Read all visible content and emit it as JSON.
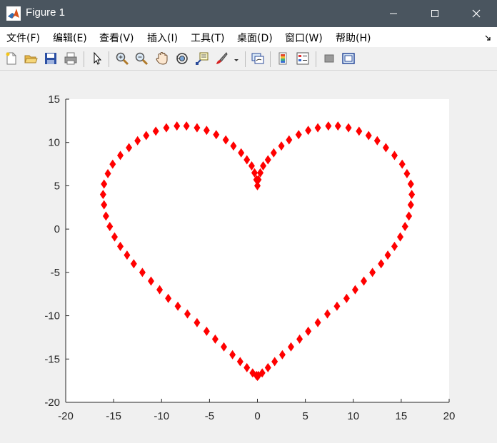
{
  "window": {
    "title": "Figure 1",
    "title_bar_color": "#4a555f"
  },
  "menu": {
    "items": [
      "文件(F)",
      "编辑(E)",
      "查看(V)",
      "插入(I)",
      "工具(T)",
      "桌面(D)",
      "窗口(W)",
      "帮助(H)"
    ]
  },
  "toolbar": {
    "icons": [
      "new-figure-icon",
      "open-file-icon",
      "save-icon",
      "print-icon",
      "edit-plot-arrow-icon",
      "zoom-in-icon",
      "zoom-out-icon",
      "pan-hand-icon",
      "rotate-3d-icon",
      "data-cursor-icon",
      "brush-icon",
      "brush-dropdown-icon",
      "link-plot-icon",
      "insert-colorbar-icon",
      "insert-legend-icon",
      "hide-plot-tools-icon",
      "show-plot-tools-icon"
    ]
  },
  "chart_data": {
    "type": "scatter",
    "marker": "diamond",
    "marker_color": "#ff0000",
    "title": "",
    "xlabel": "",
    "ylabel": "",
    "xlim": [
      -20,
      20
    ],
    "ylim": [
      -20,
      15
    ],
    "xticks": [
      "-20",
      "-15",
      "-10",
      "-5",
      "0",
      "5",
      "10",
      "15",
      "20"
    ],
    "yticks": [
      "15",
      "10",
      "5",
      "0",
      "-5",
      "-10",
      "-15",
      "-20"
    ],
    "grid": false,
    "points": [
      [
        0,
        5
      ],
      [
        0.1,
        5.7
      ],
      [
        0.3,
        6.5
      ],
      [
        0.6,
        7.3
      ],
      [
        1.1,
        8.0
      ],
      [
        1.7,
        8.8
      ],
      [
        2.5,
        9.6
      ],
      [
        3.3,
        10.3
      ],
      [
        4.3,
        10.9
      ],
      [
        5.3,
        11.4
      ],
      [
        6.3,
        11.7
      ],
      [
        7.4,
        11.9
      ],
      [
        8.4,
        11.9
      ],
      [
        9.5,
        11.7
      ],
      [
        10.6,
        11.3
      ],
      [
        11.6,
        10.8
      ],
      [
        12.5,
        10.2
      ],
      [
        13.4,
        9.4
      ],
      [
        14.3,
        8.5
      ],
      [
        15.1,
        7.5
      ],
      [
        15.6,
        6.4
      ],
      [
        16,
        5.2
      ],
      [
        16.1,
        4.0
      ],
      [
        16,
        2.8
      ],
      [
        15.8,
        1.5
      ],
      [
        15.4,
        0.3
      ],
      [
        14.9,
        -0.9
      ],
      [
        14.3,
        -2.0
      ],
      [
        13.6,
        -3.0
      ],
      [
        12.9,
        -4.0
      ],
      [
        12.0,
        -5.0
      ],
      [
        11.1,
        -6.0
      ],
      [
        10.2,
        -7.0
      ],
      [
        9.3,
        -8.0
      ],
      [
        8.3,
        -8.9
      ],
      [
        7.3,
        -9.8
      ],
      [
        6.3,
        -10.8
      ],
      [
        5.3,
        -11.8
      ],
      [
        4.4,
        -12.7
      ],
      [
        3.5,
        -13.6
      ],
      [
        2.6,
        -14.5
      ],
      [
        1.8,
        -15.3
      ],
      [
        1.1,
        -16.0
      ],
      [
        0.5,
        -16.6
      ],
      [
        0.1,
        -16.9
      ],
      [
        0,
        -17
      ],
      [
        -0.1,
        5.7
      ],
      [
        -0.3,
        6.5
      ],
      [
        -0.6,
        7.3
      ],
      [
        -1.1,
        8.0
      ],
      [
        -1.7,
        8.8
      ],
      [
        -2.5,
        9.6
      ],
      [
        -3.3,
        10.3
      ],
      [
        -4.3,
        10.9
      ],
      [
        -5.3,
        11.4
      ],
      [
        -6.3,
        11.7
      ],
      [
        -7.4,
        11.9
      ],
      [
        -8.4,
        11.9
      ],
      [
        -9.5,
        11.7
      ],
      [
        -10.6,
        11.3
      ],
      [
        -11.6,
        10.8
      ],
      [
        -12.5,
        10.2
      ],
      [
        -13.4,
        9.4
      ],
      [
        -14.3,
        8.5
      ],
      [
        -15.1,
        7.5
      ],
      [
        -15.6,
        6.4
      ],
      [
        -16,
        5.2
      ],
      [
        -16.1,
        4.0
      ],
      [
        -16,
        2.8
      ],
      [
        -15.8,
        1.5
      ],
      [
        -15.4,
        0.3
      ],
      [
        -14.9,
        -0.9
      ],
      [
        -14.3,
        -2.0
      ],
      [
        -13.6,
        -3.0
      ],
      [
        -12.9,
        -4.0
      ],
      [
        -12.0,
        -5.0
      ],
      [
        -11.1,
        -6.0
      ],
      [
        -10.2,
        -7.0
      ],
      [
        -9.3,
        -8.0
      ],
      [
        -8.3,
        -8.9
      ],
      [
        -7.3,
        -9.8
      ],
      [
        -6.3,
        -10.8
      ],
      [
        -5.3,
        -11.8
      ],
      [
        -4.4,
        -12.7
      ],
      [
        -3.5,
        -13.6
      ],
      [
        -2.6,
        -14.5
      ],
      [
        -1.8,
        -15.3
      ],
      [
        -1.1,
        -16.0
      ],
      [
        -0.5,
        -16.6
      ],
      [
        -0.1,
        -16.9
      ]
    ]
  }
}
